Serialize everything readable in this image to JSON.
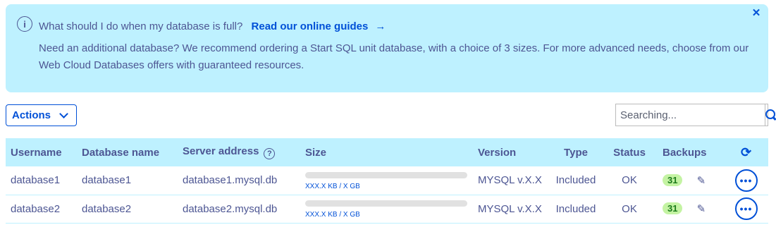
{
  "banner": {
    "question": "What should I do when my database is full?",
    "link": "Read our online guides",
    "body": "Need an additional database? We recommend ordering a Start SQL unit database, with a choice of 3 sizes. For more advanced needs, choose from our Web Cloud Databases offers with guaranteed resources."
  },
  "toolbar": {
    "actions_label": "Actions"
  },
  "search": {
    "placeholder": "Searching..."
  },
  "table": {
    "headers": {
      "username": "Username",
      "database_name": "Database name",
      "server_address": "Server address",
      "size": "Size",
      "version": "Version",
      "type": "Type",
      "status": "Status",
      "backups": "Backups"
    },
    "rows": [
      {
        "username": "database1",
        "database_name": "database1",
        "server_address": "database1.mysql.db",
        "size_text": "XXX.X KB / X GB",
        "size_fraction": 0,
        "version": "MYSQL v.X.X",
        "type": "Included",
        "status": "OK",
        "backups": "31"
      },
      {
        "username": "database2",
        "database_name": "database2",
        "server_address": "database2.mysql.db",
        "size_text": "XXX.X KB / X GB",
        "size_fraction": 0,
        "version": "MYSQL v.X.X",
        "type": "Included",
        "status": "OK",
        "backups": "31"
      }
    ]
  },
  "icons": {
    "info": "info-icon",
    "close": "close-icon",
    "search": "search-icon",
    "refresh": "refresh-icon",
    "edit": "edit-icon",
    "more": "more-options-icon"
  },
  "colors": {
    "accent": "#0050d7",
    "banner_bg": "#bef1ff",
    "text": "#4d5693",
    "badge_bg": "#c4f3a3"
  }
}
